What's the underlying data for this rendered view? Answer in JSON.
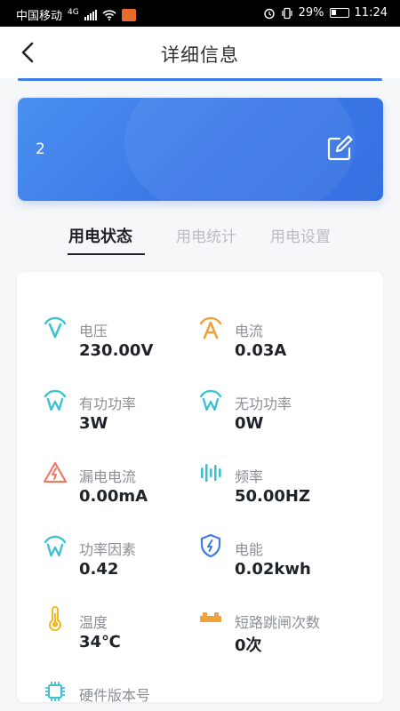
{
  "status_bar": {
    "carrier": "中国移动",
    "network": "4G",
    "battery": "29%",
    "time": "11:24"
  },
  "header": {
    "title": "详细信息",
    "back_icon": "chevron-left-icon"
  },
  "device": {
    "name": "2",
    "edit_icon": "edit-icon"
  },
  "tabs": [
    {
      "label": "用电状态",
      "active": true
    },
    {
      "label": "用电统计",
      "active": false
    },
    {
      "label": "用电设置",
      "active": false
    }
  ],
  "metrics": [
    {
      "icon": "voltage-icon",
      "label": "电压",
      "value": "230.00V",
      "color": "#3ec1d3"
    },
    {
      "icon": "current-icon",
      "label": "电流",
      "value": "0.03A",
      "color": "#f0a23a"
    },
    {
      "icon": "active-power-icon",
      "label": "有功功率",
      "value": "3W",
      "color": "#3ec1d3"
    },
    {
      "icon": "reactive-power-icon",
      "label": "无功功率",
      "value": "0W",
      "color": "#3ec1d3"
    },
    {
      "icon": "leakage-warning-icon",
      "label": "漏电电流",
      "value": "0.00mA",
      "color": "#f07a63"
    },
    {
      "icon": "frequency-icon",
      "label": "频率",
      "value": "50.00HZ",
      "color": "#3ec1d3"
    },
    {
      "icon": "power-factor-icon",
      "label": "功率因素",
      "value": "0.42",
      "color": "#3ec1d3"
    },
    {
      "icon": "energy-shield-icon",
      "label": "电能",
      "value": "0.02kwh",
      "color": "#3d7be6"
    },
    {
      "icon": "thermometer-icon",
      "label": "温度",
      "value": "34℃",
      "color": "#f5b623"
    },
    {
      "icon": "trip-count-icon",
      "label": "短路跳闸次数",
      "value": "0次",
      "color": "#f0a23a"
    },
    {
      "icon": "chip-icon",
      "label": "硬件版本号",
      "value": "",
      "color": "#3ec1d3"
    }
  ]
}
